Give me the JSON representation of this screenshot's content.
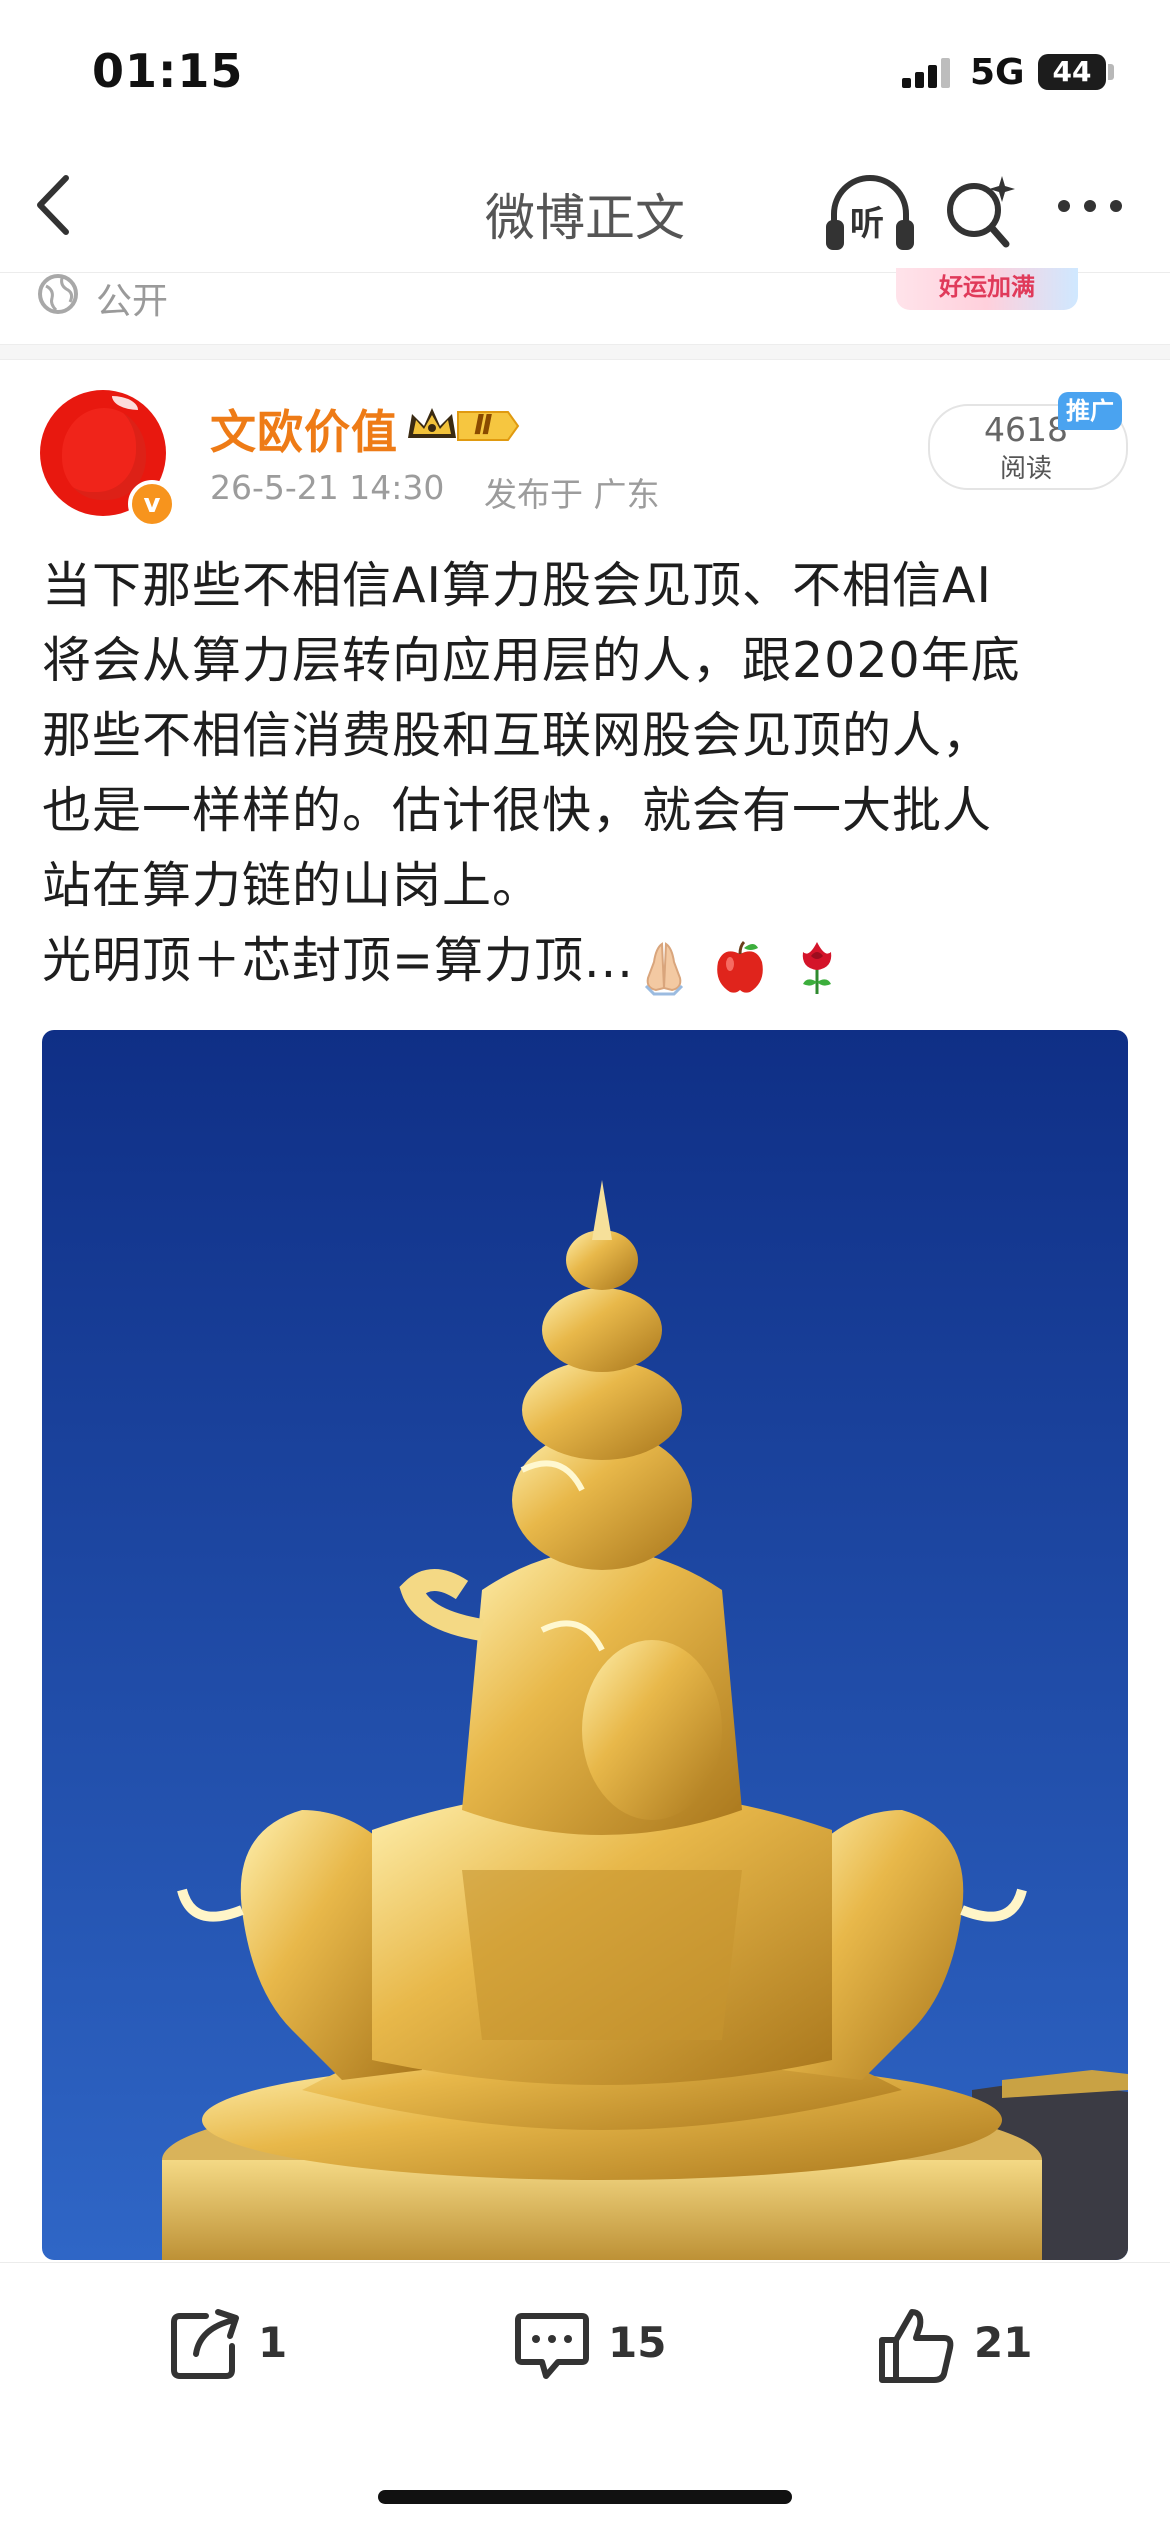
{
  "status_bar": {
    "time": "01:15",
    "network": "5G",
    "battery": "44"
  },
  "nav": {
    "title": "微博正文",
    "listen_label": "听",
    "icons": [
      "back-icon",
      "headphones-icon",
      "search-sparkle-icon",
      "more-icon"
    ]
  },
  "previous_post": {
    "visibility": "公开",
    "banner_text": "好运加满"
  },
  "post": {
    "author": "文欧价值",
    "vip_level": "Ⅱ",
    "verified_mark": "v",
    "time": "26-5-21 14:30",
    "location": "发布于 广东",
    "reads_count": "4618",
    "reads_label": "阅读",
    "promo_tag": "推广",
    "text_lines": [
      "当下那些不相信AI算力股会见顶、不相信AI",
      "将会从算力层转向应用层的人，跟2020年底",
      "那些不相信消费股和互联网股会见顶的人，",
      "也是一样样的。估计很快，就会有一大批人",
      "站在算力链的山岗上。",
      "光明顶＋芯封顶=算力顶..."
    ],
    "emojis": [
      "folded-hands-icon",
      "red-apple-icon",
      "rose-icon"
    ]
  },
  "actions": {
    "share_count": "1",
    "comment_count": "15",
    "like_count": "21"
  },
  "colors": {
    "author_orange": "#ee7b16",
    "sky_blue": "#123f9e",
    "gold": "#e8b84a",
    "promo_blue": "#4aa3f0"
  }
}
